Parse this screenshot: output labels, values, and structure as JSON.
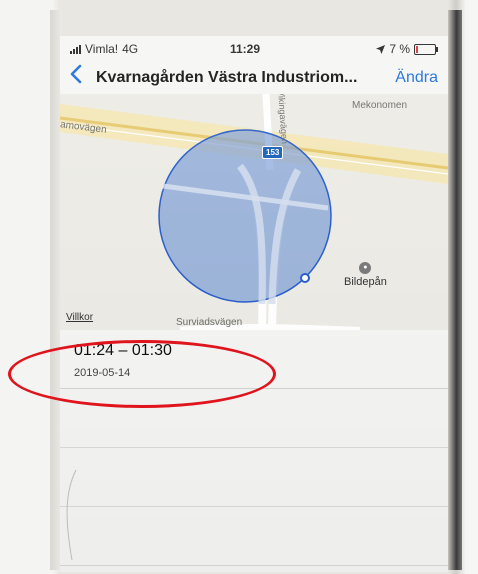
{
  "status_bar": {
    "carrier": "Vimla!",
    "network": "4G",
    "time": "11:29",
    "battery": "7 %",
    "location_icon": "location-arrow-icon"
  },
  "nav": {
    "back_icon": "chevron-left-icon",
    "title": "Kvarnagården Västra Industriom...",
    "edit_label": "Ändra"
  },
  "map": {
    "labels": {
      "mekonomen": "Mekonomen",
      "west_road": "amovägen",
      "north_road": "Vikingavägen",
      "south_road": "Surviadsvägen",
      "route": "153"
    },
    "poi": {
      "label": "Bildepån",
      "icon": "car-icon"
    },
    "conditions_link": "Villkor",
    "circle_color": "#7d9ed6",
    "circle_border": "#2b5fc9"
  },
  "entries": [
    {
      "time": "01:24 – 01:30",
      "date": "2019-05-14"
    }
  ],
  "colors": {
    "accent": "#1a6fe0",
    "annotation": "#e0141d"
  }
}
